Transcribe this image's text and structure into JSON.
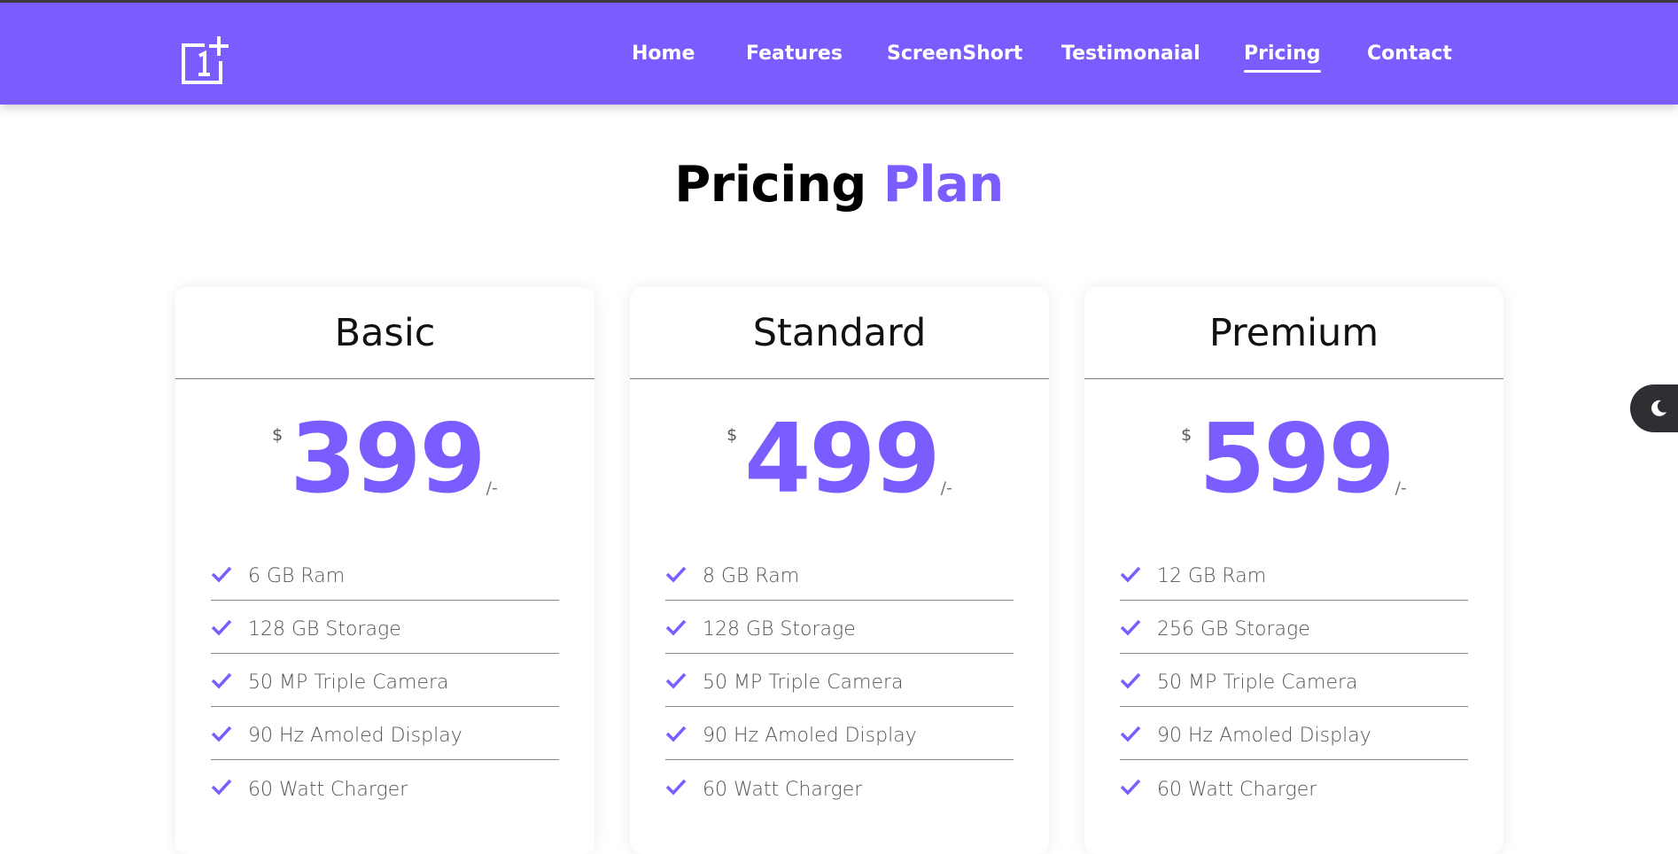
{
  "nav": {
    "logo_icon": "oneplus-logo-icon",
    "links": [
      {
        "label": "Home",
        "active": false
      },
      {
        "label": "Features",
        "active": false
      },
      {
        "label": "ScreenShort",
        "active": false
      },
      {
        "label": "Testimonaial",
        "active": false
      },
      {
        "label": "Pricing",
        "active": true
      },
      {
        "label": "Contact",
        "active": false
      }
    ]
  },
  "section": {
    "title_main": "Pricing",
    "title_accent": "Plan"
  },
  "plans": [
    {
      "name": "Basic",
      "currency": "$",
      "price": "399",
      "suffix": "/-",
      "features": [
        "6 GB Ram",
        "128 GB Storage",
        "50 MP Triple Camera",
        "90 Hz Amoled Display",
        "60 Watt Charger"
      ]
    },
    {
      "name": "Standard",
      "currency": "$",
      "price": "499",
      "suffix": "/-",
      "features": [
        "8 GB Ram",
        "128 GB Storage",
        "50 MP Triple Camera",
        "90 Hz Amoled Display",
        "60 Watt Charger"
      ]
    },
    {
      "name": "Premium",
      "currency": "$",
      "price": "599",
      "suffix": "/-",
      "features": [
        "12 GB Ram",
        "256 GB Storage",
        "50 MP Triple Camera",
        "90 Hz Amoled Display",
        "60 Watt Charger"
      ]
    }
  ],
  "theme_toggle": {
    "icon": "moon-icon"
  },
  "colors": {
    "brand": "#7b5cff",
    "nav_text": "#ffffff",
    "toggle_bg": "#2d2f33"
  }
}
